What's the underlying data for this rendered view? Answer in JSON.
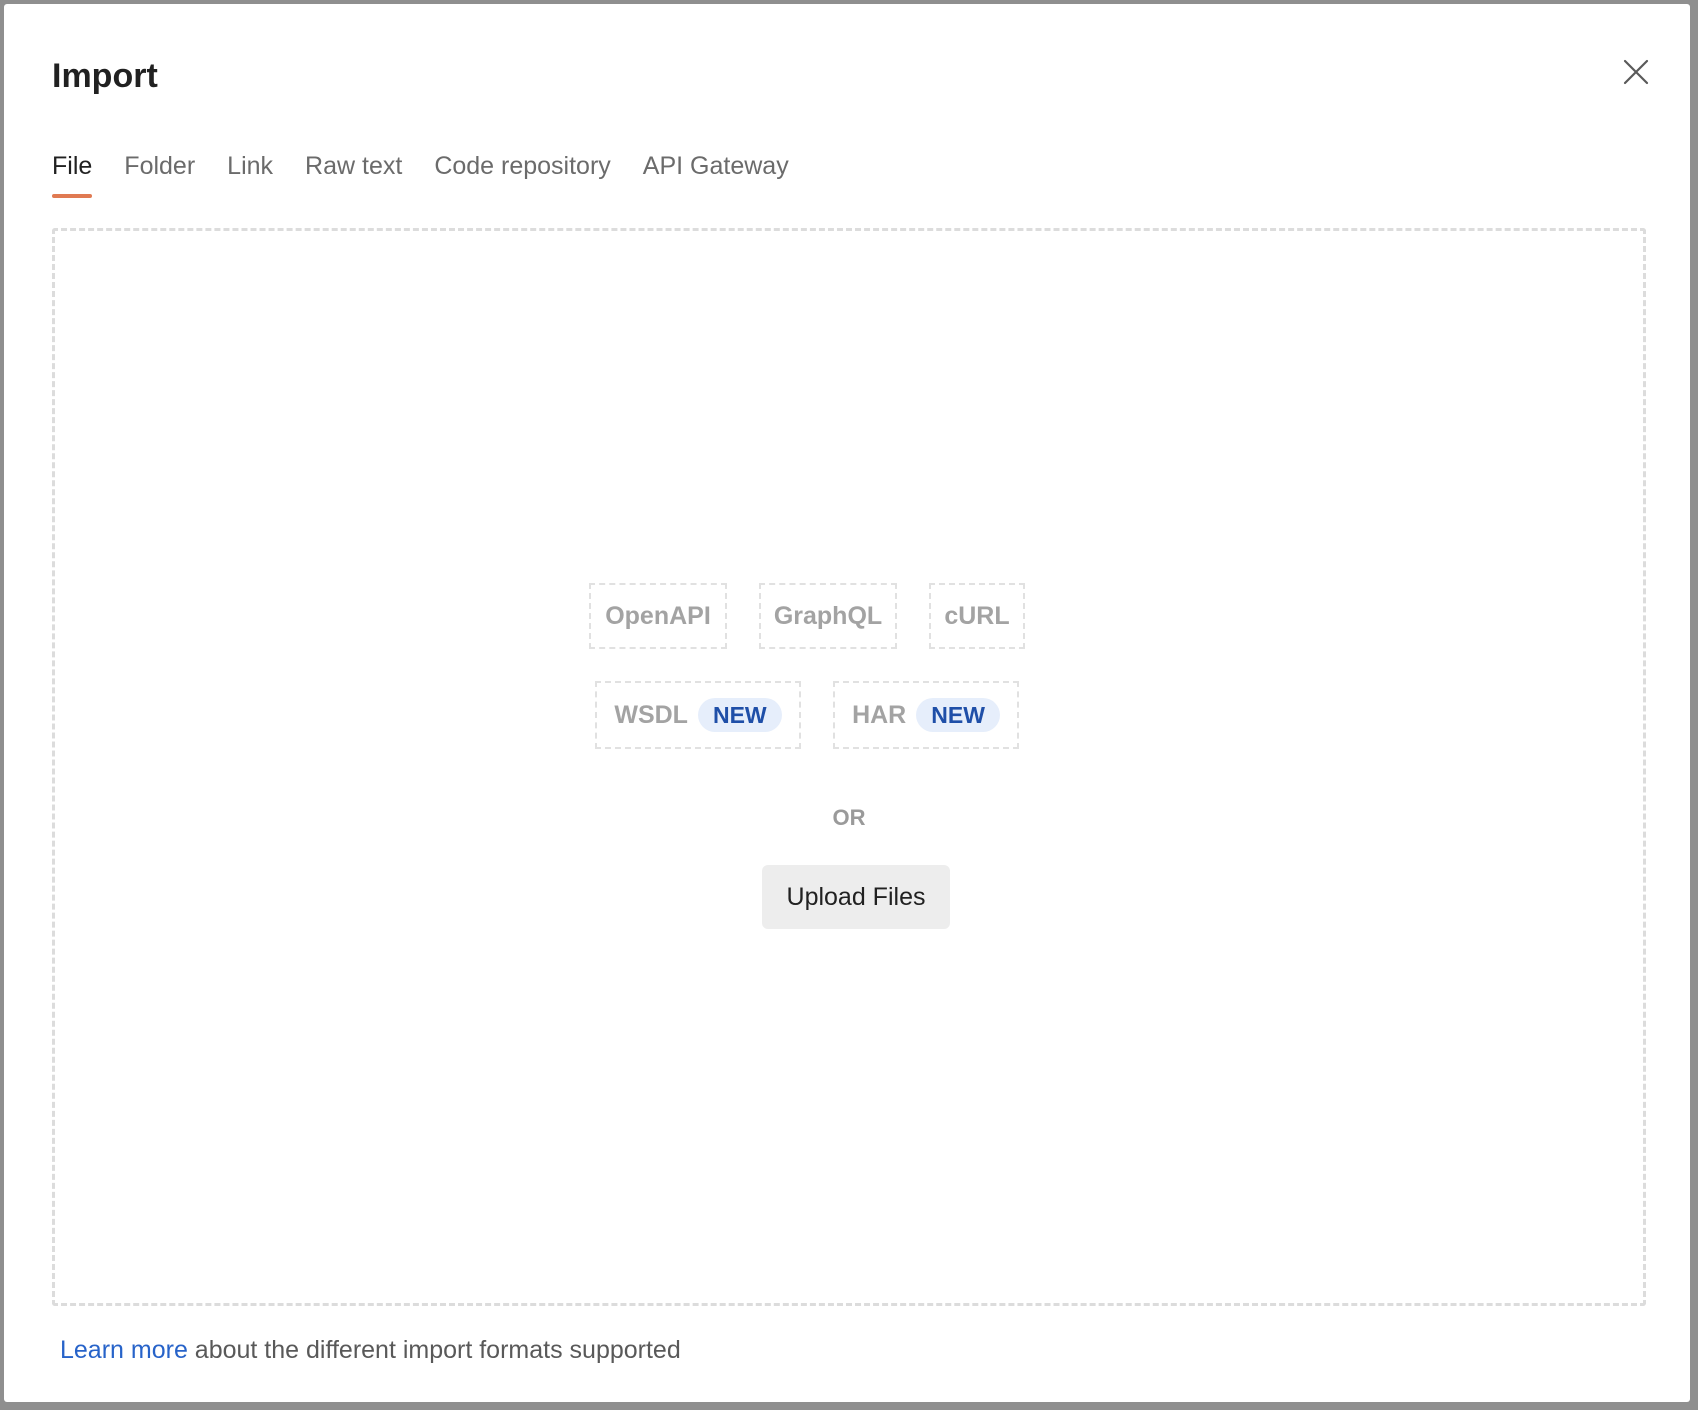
{
  "modal": {
    "title": "Import",
    "close_icon": "close-icon"
  },
  "tabs": [
    {
      "label": "File",
      "active": true
    },
    {
      "label": "Folder",
      "active": false
    },
    {
      "label": "Link",
      "active": false
    },
    {
      "label": "Raw text",
      "active": false
    },
    {
      "label": "Code repository",
      "active": false
    },
    {
      "label": "API Gateway",
      "active": false
    }
  ],
  "dropzone": {
    "formats": [
      {
        "label": "OpenAPI"
      },
      {
        "label": "GraphQL"
      },
      {
        "label": "cURL"
      },
      {
        "label": "WSDL",
        "badge": "NEW"
      },
      {
        "label": "HAR",
        "badge": "NEW"
      }
    ],
    "or_label": "OR",
    "upload_label": "Upload Files"
  },
  "footer": {
    "link_text": "Learn more",
    "text": " about the different import formats supported"
  },
  "colors": {
    "accent_tab_underline": "#e07a52",
    "link": "#2763c9",
    "badge_bg": "#e6eefb",
    "badge_text": "#1f4fa8"
  }
}
